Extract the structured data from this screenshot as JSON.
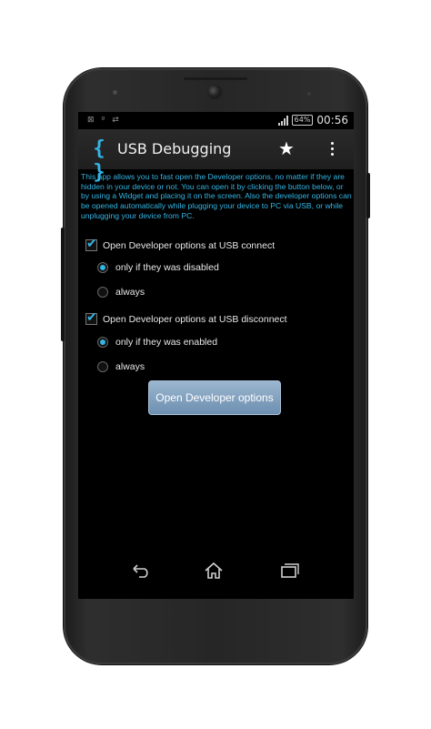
{
  "status_bar": {
    "battery": "64%",
    "time": "00:56",
    "icons": [
      "notification-icon",
      "signal-icon",
      "usb-icon"
    ]
  },
  "action_bar": {
    "title": "USB Debugging",
    "app_icon": "{ }",
    "star_icon": "★"
  },
  "description": "This app allows you to fast open the Developer options, no matter if they are hidden in your device or not. You can open it by clicking the button below, or by using a Widget and placing it on the screen. Also the developer options can be opened automatically while plugging your device to PC via USB, or while unplugging your device from PC.",
  "options": {
    "connect": {
      "label": "Open Developer options at USB connect",
      "checked": true,
      "radios": [
        {
          "label": "only if they was disabled",
          "selected": true
        },
        {
          "label": "always",
          "selected": false
        }
      ]
    },
    "disconnect": {
      "label": "Open Developer options at USB disconnect",
      "checked": true,
      "radios": [
        {
          "label": "only if they was enabled",
          "selected": true
        },
        {
          "label": "always",
          "selected": false
        }
      ]
    }
  },
  "button": {
    "label": "Open Developer options"
  },
  "colors": {
    "accent": "#33b5e5",
    "button": "#7e9fbf"
  }
}
